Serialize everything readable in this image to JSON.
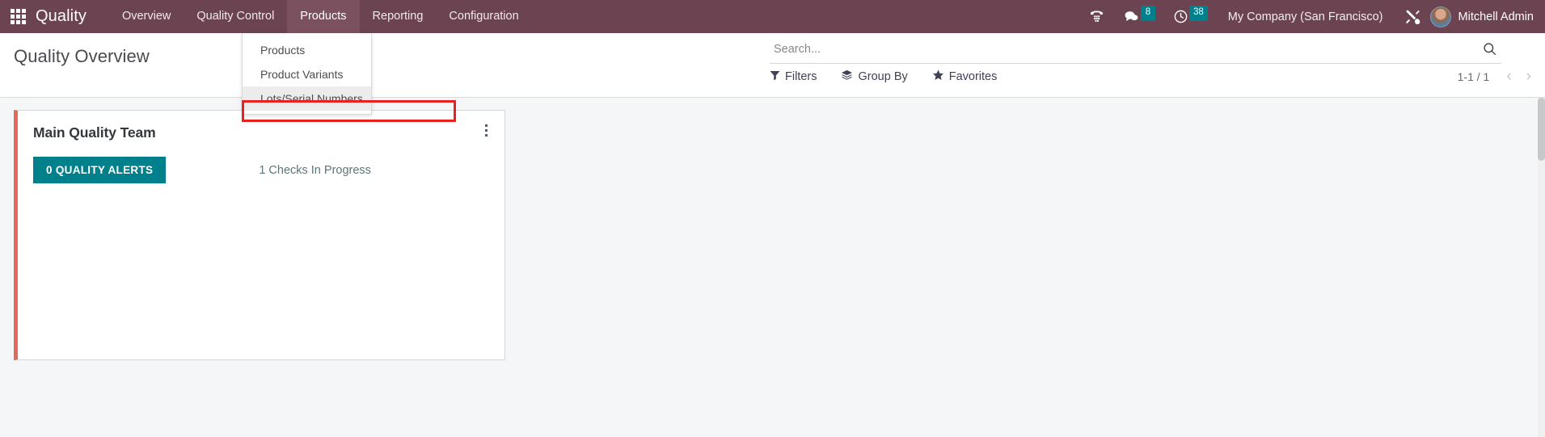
{
  "navbar": {
    "apps_icon": "apps-grid-icon",
    "brand": "Quality",
    "menus": [
      {
        "label": "Overview",
        "active": false
      },
      {
        "label": "Quality Control",
        "active": false
      },
      {
        "label": "Products",
        "active": true
      },
      {
        "label": "Reporting",
        "active": false
      },
      {
        "label": "Configuration",
        "active": false
      }
    ],
    "systray": {
      "phone_icon": "phone-icon",
      "messages_icon": "chat-bubble-icon",
      "messages_count": "8",
      "activities_icon": "clock-icon",
      "activities_count": "38",
      "company": "My Company (San Francisco)",
      "tools_icon": "wrench-screwdriver-icon",
      "user": "Mitchell Admin"
    },
    "accent_badge_color": "#00808a",
    "navbar_color": "#6b4351"
  },
  "dropdown": {
    "items": [
      {
        "label": "Products",
        "highlighted": false
      },
      {
        "label": "Product Variants",
        "highlighted": false
      },
      {
        "label": "Lots/Serial Numbers",
        "highlighted": true
      }
    ],
    "highlight_border_color": "#e8231f"
  },
  "control_panel": {
    "title": "Quality Overview",
    "search": {
      "placeholder": "Search...",
      "value": "",
      "icon": "search-icon"
    },
    "filters": [
      {
        "label": "Filters",
        "icon": "funnel-icon"
      },
      {
        "label": "Group By",
        "icon": "layers-icon"
      },
      {
        "label": "Favorites",
        "icon": "star-icon"
      }
    ],
    "pager": {
      "count": "1-1 / 1",
      "prev_icon": "chevron-left-icon",
      "next_icon": "chevron-right-icon"
    }
  },
  "kanban": {
    "cards": [
      {
        "title": "Main Quality Team",
        "stripe_color": "#e06a5c",
        "alerts_label": "0 QUALITY ALERTS",
        "alerts_color": "#00808a",
        "checks_label": "1 Checks In Progress",
        "menu_icon": "kebab-menu-icon"
      }
    ]
  }
}
